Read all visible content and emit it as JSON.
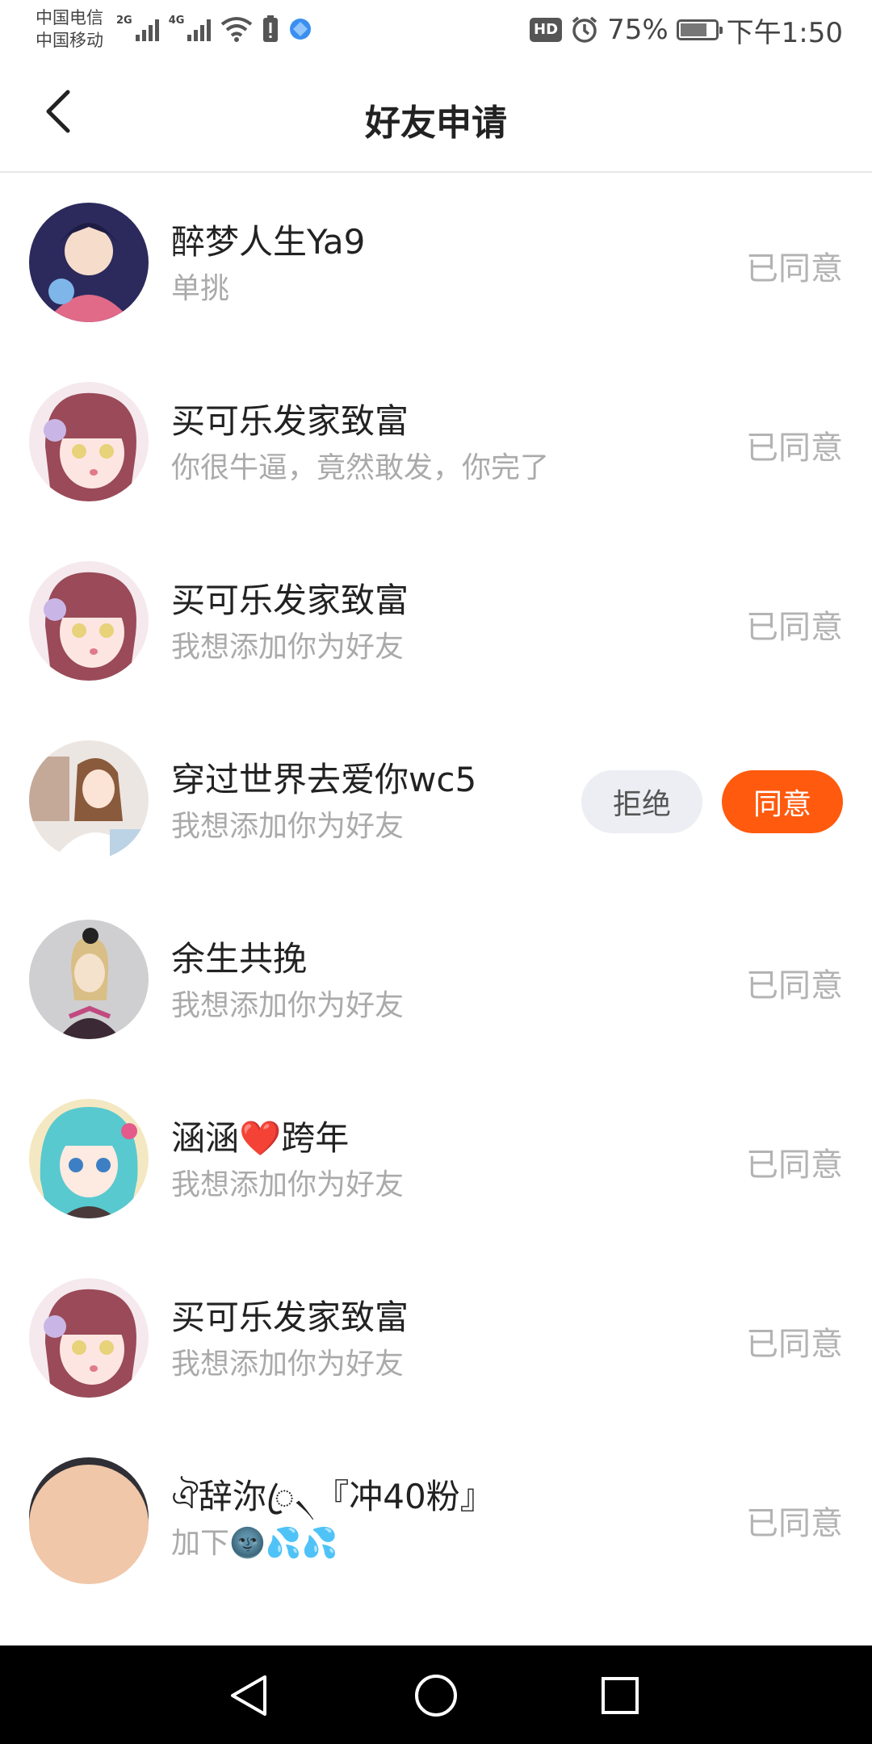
{
  "status_bar": {
    "carrier_1": "中国电信",
    "carrier_2": "中国移动",
    "net_1": "2G",
    "net_2": "4G",
    "hd": "HD",
    "battery_text": "75%",
    "battery_level": 0.75,
    "time": "下午1:50"
  },
  "header": {
    "title": "好友申请"
  },
  "requests": [
    {
      "name": "醉梦人生Ya9",
      "message": "单挑",
      "status": "已同意",
      "avatar_color": "#6b5aa8"
    },
    {
      "name": "买可乐发家致富",
      "message": "你很牛逼，竟然敢发，你完了",
      "status": "已同意",
      "avatar_color": "#b5666e"
    },
    {
      "name": "买可乐发家致富",
      "message": "我想添加你为好友",
      "status": "已同意",
      "avatar_color": "#b5666e"
    },
    {
      "name": "穿过世界去爱你wc5",
      "message": "我想添加你为好友",
      "reject_label": "拒绝",
      "accept_label": "同意",
      "avatar_color": "#c9b9a8"
    },
    {
      "name": "余生共挽",
      "message": "我想添加你为好友",
      "status": "已同意",
      "avatar_color": "#cfcfd1"
    },
    {
      "name": "涵涵❤️跨年",
      "message": "我想添加你为好友",
      "status": "已同意",
      "avatar_color": "#5fcfd0"
    },
    {
      "name": "买可乐发家致富",
      "message": "我想添加你为好友",
      "status": "已同意",
      "avatar_color": "#b5666e"
    },
    {
      "name": "ঐ辞沵ꦿ৲『冲40粉』",
      "message": "加下🌚💦💦",
      "status": "已同意",
      "avatar_color": "#e8e8ea"
    }
  ],
  "colors": {
    "accent": "#ff5a0d",
    "reject_bg": "#eceef3",
    "status_gray": "#b3b3b3"
  },
  "nav": {
    "back_icon": "triangle-back-icon",
    "home_icon": "circle-home-icon",
    "recents_icon": "square-recents-icon"
  }
}
